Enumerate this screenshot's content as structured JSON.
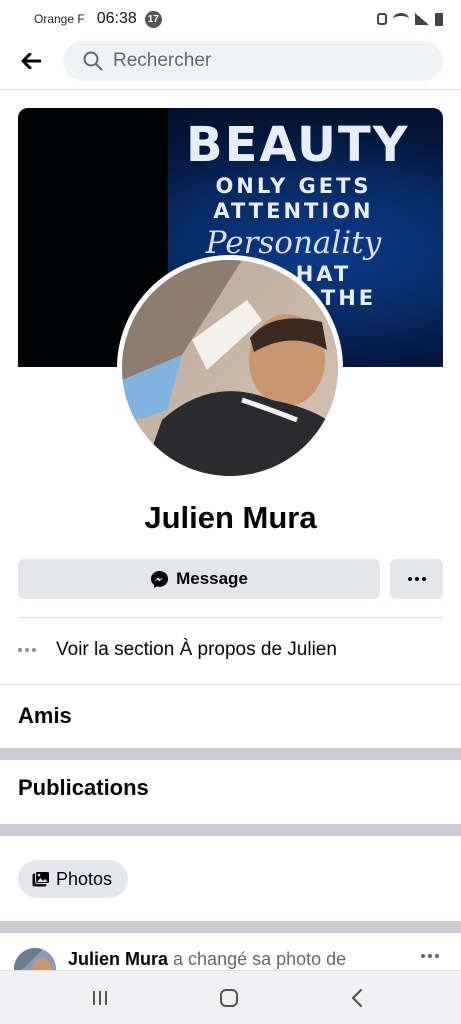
{
  "status_bar": {
    "carrier": "Orange F",
    "time": "06:38",
    "notification_count": "17"
  },
  "search": {
    "placeholder": "Rechercher"
  },
  "cover": {
    "line1": "BEAUTY",
    "line2": "ONLY GETS",
    "line3": "ATTENTION",
    "line4": "Personality",
    "line5": "HAT",
    "line6": "THE"
  },
  "profile": {
    "name": "Julien Mura"
  },
  "actions": {
    "message_label": "Message"
  },
  "about": {
    "label": "Voir la section À propos de Julien"
  },
  "sections": {
    "friends": "Amis",
    "posts": "Publications"
  },
  "photos": {
    "label": "Photos"
  },
  "post": {
    "author": "Julien Mura",
    "text": " a changé sa photo de"
  },
  "colors": {
    "chip_background": "#e4e6eb",
    "search_background": "#f0f2f5",
    "section_separator": "#c9ccd1",
    "messenger_blue": "#0084ff"
  }
}
